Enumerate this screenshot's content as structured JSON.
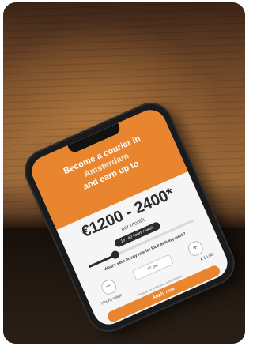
{
  "scene": {
    "description_colors": {
      "accent": "#e8852e",
      "dark": "#2b2b2b"
    }
  },
  "screen": {
    "hero": {
      "line1": "Become a courier in",
      "city": "Amsterdam",
      "line3": "and earn up to"
    },
    "pay_range": "€1200 - 2400*",
    "per_label": "per month",
    "hours_pill": "16 - 40 hours / week",
    "hours_slider_level": 0.25,
    "question": "What's your hourly rate for food delivery work?",
    "stepper": {
      "minus": "−",
      "value": "12 per",
      "plus": "+"
    },
    "wage_label": "Hourly wage",
    "wage_value": "€ 16.00",
    "note": "*based on a full-time commitment",
    "cta_label": "Apply now"
  }
}
